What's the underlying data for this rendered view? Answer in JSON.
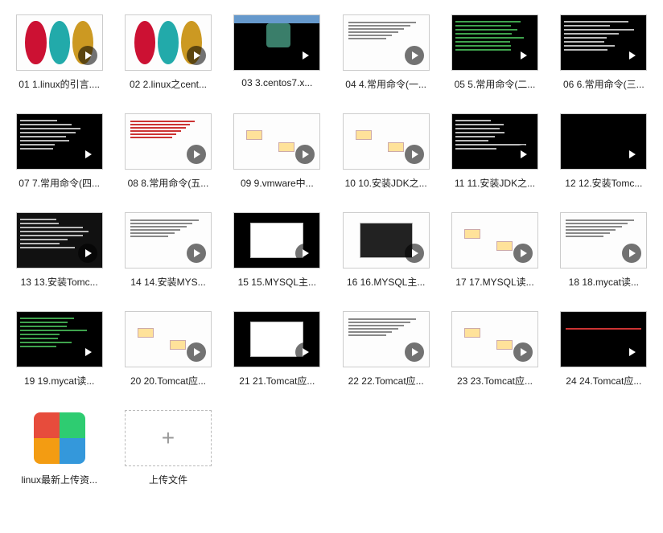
{
  "videos": [
    {
      "label": "01 1.linux的引言....",
      "style": "light",
      "deco": "logos"
    },
    {
      "label": "02 2.linux之cent...",
      "style": "light",
      "deco": "logos"
    },
    {
      "label": "03 3.centos7.x...",
      "style": "dark",
      "deco": "wtop"
    },
    {
      "label": "04 4.常用命令(一...",
      "style": "light",
      "deco": "lines"
    },
    {
      "label": "05 5.常用命令(二...",
      "style": "dark",
      "deco": "termg"
    },
    {
      "label": "06 6.常用命令(三...",
      "style": "dark",
      "deco": "termw"
    },
    {
      "label": "07 7.常用命令(四...",
      "style": "dark",
      "deco": "termw"
    },
    {
      "label": "08 8.常用命令(五...",
      "style": "light",
      "deco": "linesrd"
    },
    {
      "label": "09 9.vmware中...",
      "style": "light",
      "deco": "diagram"
    },
    {
      "label": "10 10.安装JDK之...",
      "style": "light",
      "deco": "diagram"
    },
    {
      "label": "11 11.安装JDK之...",
      "style": "dark",
      "deco": "termw"
    },
    {
      "label": "12 12.安装Tomc...",
      "style": "dark",
      "deco": "blank"
    },
    {
      "label": "13 13.安装Tomc...",
      "style": "dark2",
      "deco": "termw"
    },
    {
      "label": "14 14.安装MYS...",
      "style": "light",
      "deco": "lines"
    },
    {
      "label": "15 15.MYSQL主...",
      "style": "dark",
      "deco": "panel"
    },
    {
      "label": "16 16.MYSQL主...",
      "style": "light",
      "deco": "panelb"
    },
    {
      "label": "17 17.MYSQL读...",
      "style": "light",
      "deco": "diagram"
    },
    {
      "label": "18 18.mycat读...",
      "style": "light",
      "deco": "lines"
    },
    {
      "label": "19 19.mycat读...",
      "style": "dark",
      "deco": "termg"
    },
    {
      "label": "20 20.Tomcat应...",
      "style": "light",
      "deco": "diagram"
    },
    {
      "label": "21 21.Tomcat应...",
      "style": "dark",
      "deco": "panel"
    },
    {
      "label": "22 22.Tomcat应...",
      "style": "light",
      "deco": "lines"
    },
    {
      "label": "23 23.Tomcat应...",
      "style": "light",
      "deco": "diagram"
    },
    {
      "label": "24 24.Tomcat应...",
      "style": "dark",
      "deco": "redline"
    }
  ],
  "file": {
    "label": "linux最新上传资..."
  },
  "upload": {
    "label": "上传文件",
    "glyph": "+"
  }
}
